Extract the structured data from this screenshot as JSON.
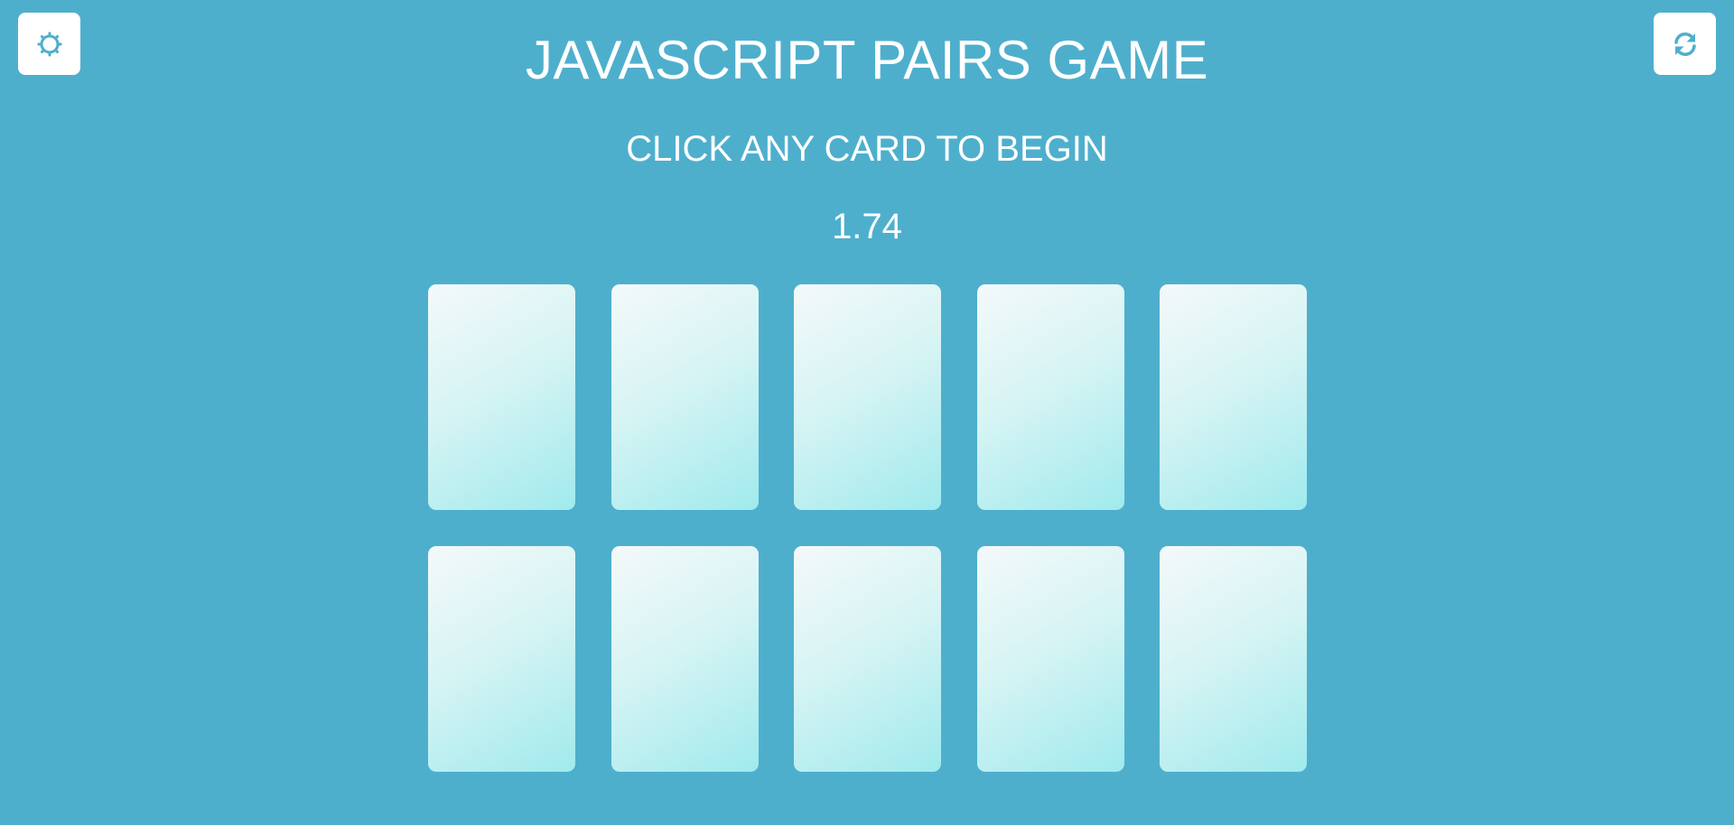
{
  "header": {
    "title": "JAVASCRIPT PAIRS GAME",
    "subtitle": "CLICK ANY CARD TO BEGIN",
    "timer": "1.74"
  },
  "controls": {
    "settings_icon": "gear-icon",
    "reset_icon": "refresh-icon"
  },
  "board": {
    "rows": 2,
    "columns": 5,
    "cards_face_down": 10
  },
  "colors": {
    "background": "#4eafcd",
    "card_gradient_start": "#f4f9fa",
    "card_gradient_end": "#a0eaed",
    "icon": "#4eafcd",
    "button": "#ffffff"
  }
}
